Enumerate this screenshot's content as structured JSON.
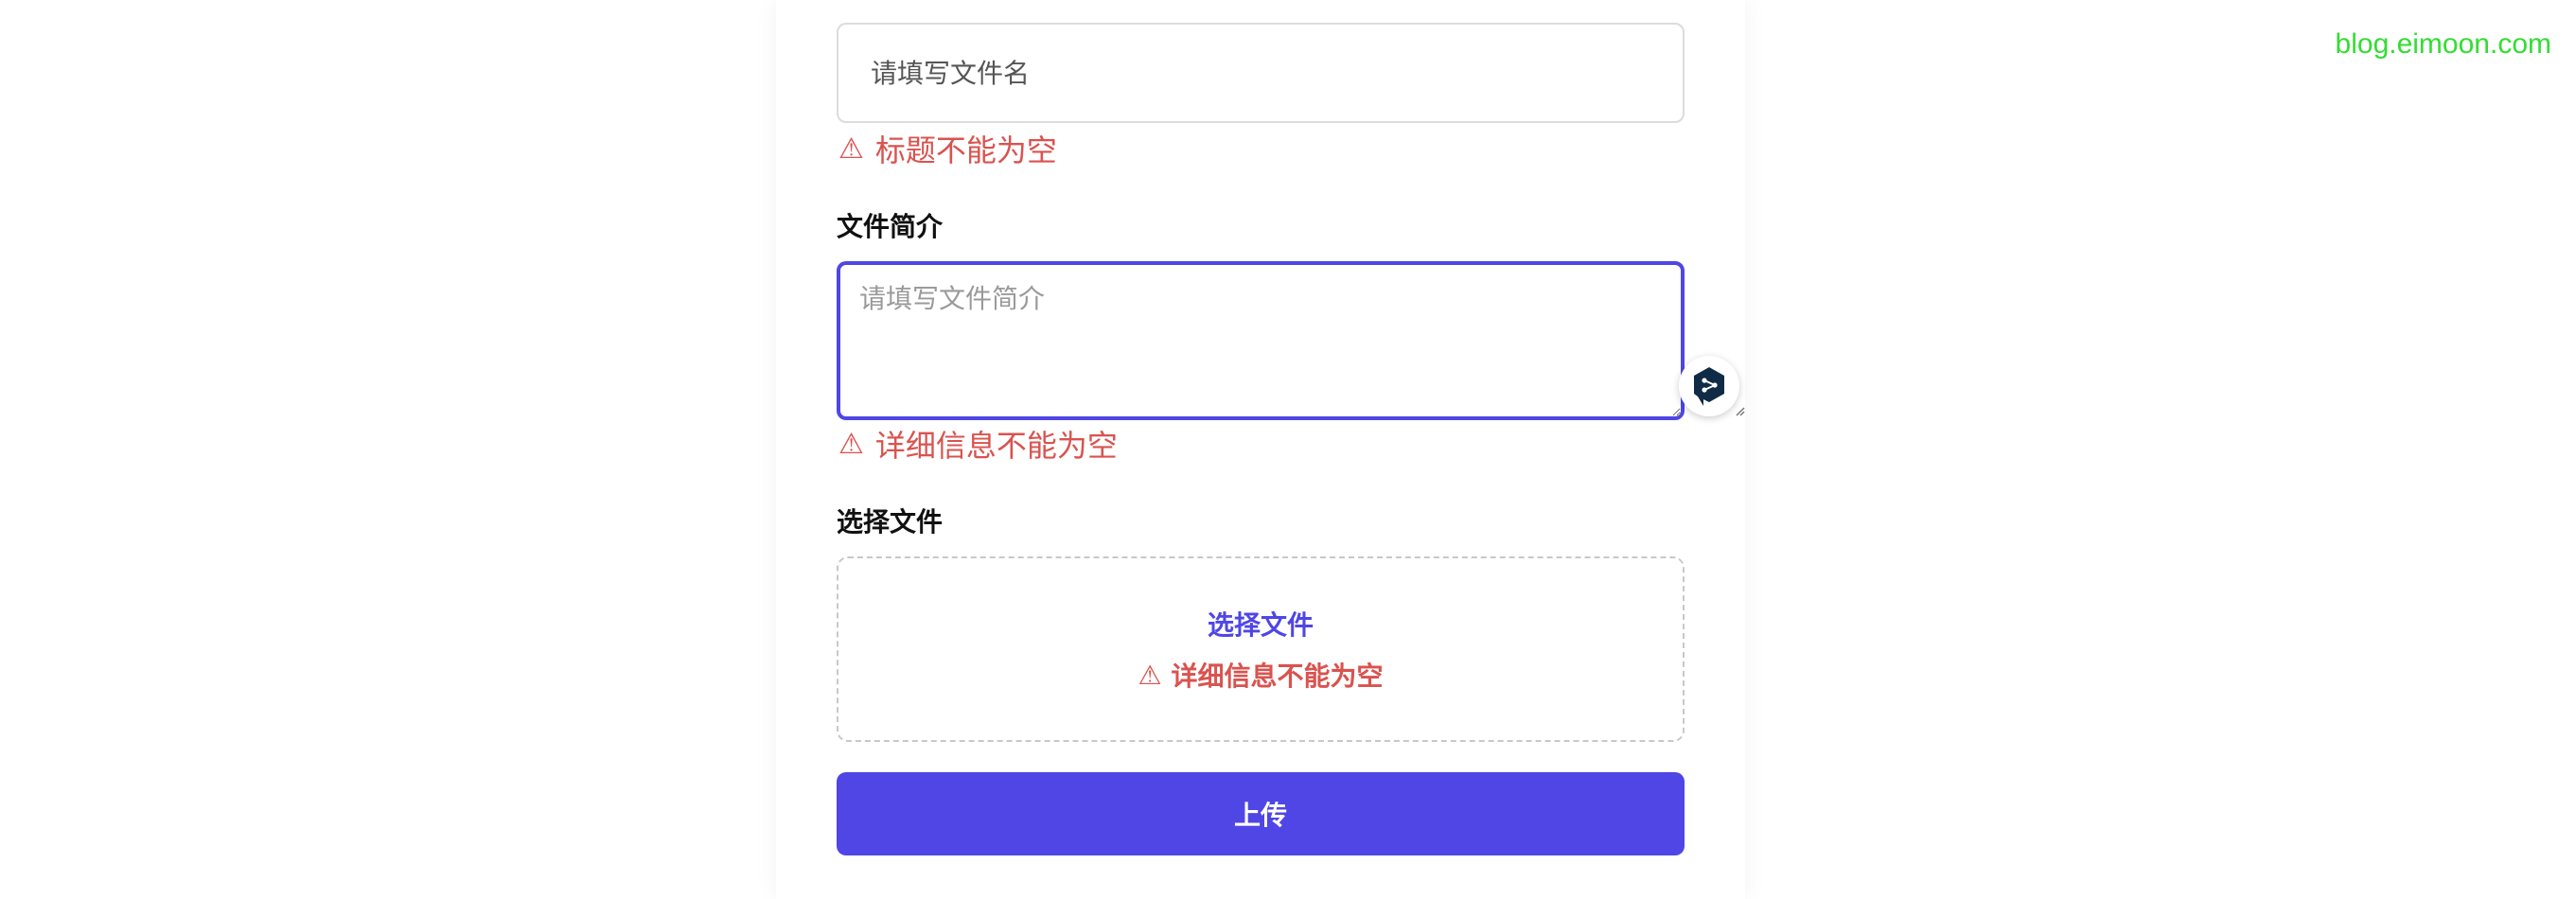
{
  "form": {
    "title_placeholder": "请填写文件名",
    "title_error": "标题不能为空",
    "description_label": "文件简介",
    "description_placeholder": "请填写文件简介",
    "description_error": "详细信息不能为空",
    "file_label": "选择文件",
    "file_link": "选择文件",
    "file_error": "详细信息不能为空",
    "upload_label": "上传",
    "warn_glyph": "⚠"
  },
  "extension": {
    "icon": "deepl-icon"
  },
  "watermark": "blog.eimoon.com",
  "colors": {
    "accent": "#4f46e5",
    "error": "#d9534f",
    "watermark": "#33dd33"
  }
}
